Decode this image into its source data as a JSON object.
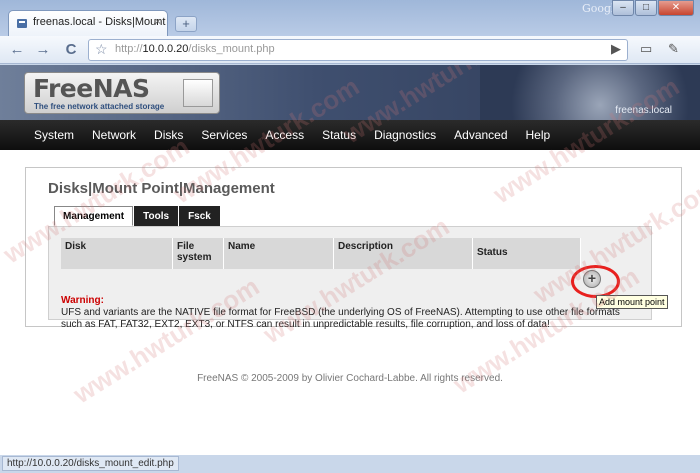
{
  "browser": {
    "tab_title": "freenas.local - Disks|Mount ...",
    "tab_close": "×",
    "new_tab": "+",
    "brand": "Google",
    "min": "–",
    "max": "□",
    "close": "✕",
    "back": "←",
    "forward": "→",
    "reload": "C",
    "star": "☆",
    "url_prefix": "http://",
    "url_host": "10.0.0.20",
    "url_path": "/disks_mount.php",
    "go": "▶",
    "page_menu": "▭",
    "tools_menu": "✎"
  },
  "freenas": {
    "logo_name": "FreeNAS",
    "logo_tagline": "The free network attached storage",
    "hostname": "freenas.local",
    "menu": [
      "System",
      "Network",
      "Disks",
      "Services",
      "Access",
      "Status",
      "Diagnostics",
      "Advanced",
      "Help"
    ]
  },
  "page": {
    "title": "Disks|Mount Point|Management",
    "tabs": [
      "Management",
      "Tools",
      "Fsck"
    ],
    "columns": [
      "Disk",
      "File system",
      "Name",
      "Description",
      "Status"
    ],
    "warning_label": "Warning:",
    "warning_text": "UFS and variants are the NATIVE file format for FreeBSD (the underlying OS of FreeNAS). Attempting to use other file formats such as FAT, FAT32, EXT2, EXT3, or NTFS can result in unpredictable results, file corruption, and loss of data!",
    "add_button": "+",
    "tooltip": "Add mount point",
    "footer": "FreeNAS © 2005-2009 by Olivier Cochard-Labbe. All rights reserved."
  },
  "watermark": "www.hwturk.com",
  "status_url": "http://10.0.0.20/disks_mount_edit.php"
}
